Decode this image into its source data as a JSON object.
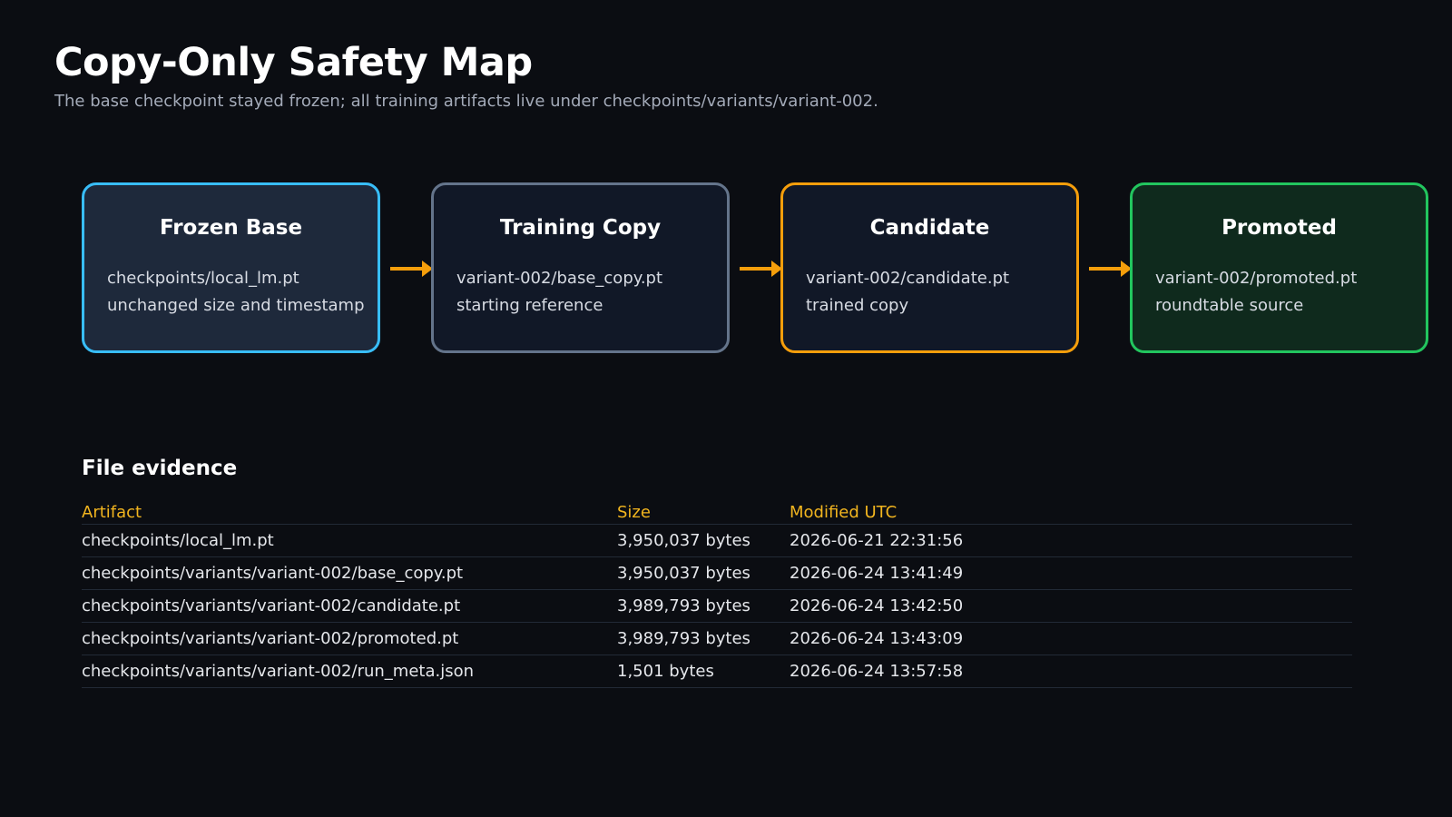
{
  "title": "Copy-Only Safety Map",
  "subtitle": "The base checkpoint stayed frozen; all training artifacts live under checkpoints/variants/variant-002.",
  "stages": [
    {
      "title": "Frozen Base",
      "line1": "checkpoints/local_lm.pt",
      "line2": "unchanged size and timestamp",
      "border_color": "#38bdf8",
      "fill_color": "#1e293b"
    },
    {
      "title": "Training Copy",
      "line1": "variant-002/base_copy.pt",
      "line2": "starting reference",
      "border_color": "#64748b",
      "fill_color": "#111827"
    },
    {
      "title": "Candidate",
      "line1": "variant-002/candidate.pt",
      "line2": "trained copy",
      "border_color": "#f59e0b",
      "fill_color": "#111827"
    },
    {
      "title": "Promoted",
      "line1": "variant-002/promoted.pt",
      "line2": "roundtable source",
      "border_color": "#22c55e",
      "fill_color": "#0f2a1d"
    }
  ],
  "arrow_color": "#f59e0b",
  "evidence": {
    "heading": "File evidence",
    "columns": [
      "Artifact",
      "Size",
      "Modified UTC"
    ],
    "rows": [
      [
        "checkpoints/local_lm.pt",
        "3,950,037 bytes",
        "2026-06-21 22:31:56"
      ],
      [
        "checkpoints/variants/variant-002/base_copy.pt",
        "3,950,037 bytes",
        "2026-06-24 13:41:49"
      ],
      [
        "checkpoints/variants/variant-002/candidate.pt",
        "3,989,793 bytes",
        "2026-06-24 13:42:50"
      ],
      [
        "checkpoints/variants/variant-002/promoted.pt",
        "3,989,793 bytes",
        "2026-06-24 13:43:09"
      ],
      [
        "checkpoints/variants/variant-002/run_meta.json",
        "1,501 bytes",
        "2026-06-24 13:57:58"
      ]
    ]
  }
}
